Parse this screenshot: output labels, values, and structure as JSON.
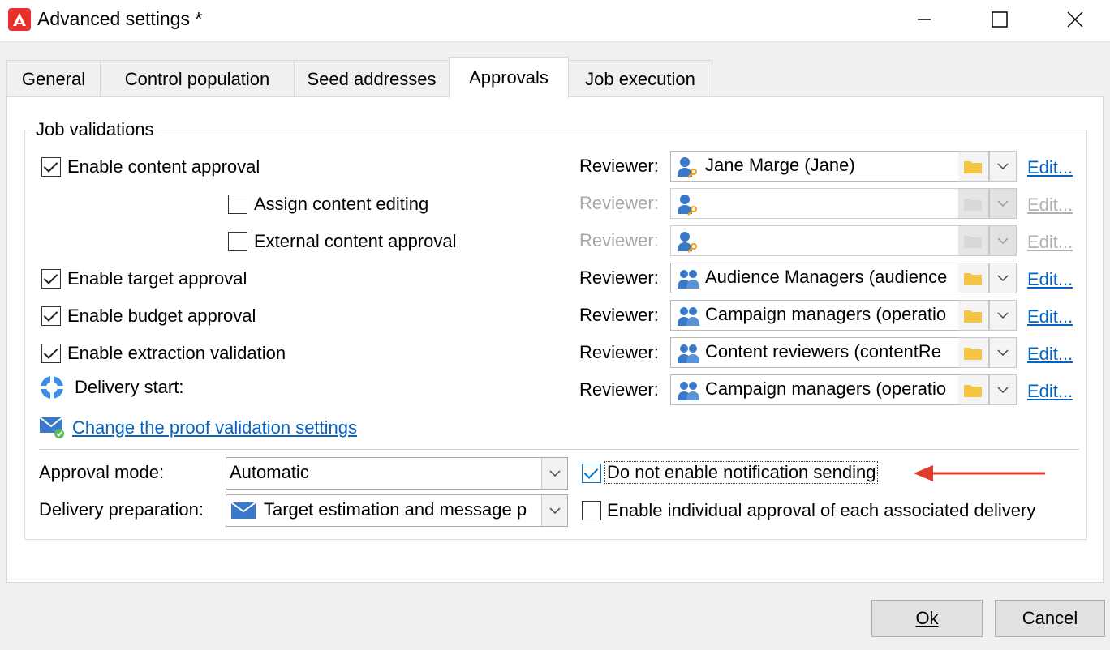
{
  "window": {
    "title": "Advanced settings *"
  },
  "tabs": [
    {
      "label": "General"
    },
    {
      "label": "Control population"
    },
    {
      "label": "Seed addresses"
    },
    {
      "label": "Approvals",
      "active": true
    },
    {
      "label": "Job execution"
    }
  ],
  "job_validations": {
    "legend": "Job validations",
    "rows": [
      {
        "label": "Enable content approval",
        "checked": true,
        "reviewer_label": "Reviewer:",
        "reviewer_value": "Jane Marge (Jane)",
        "reviewer_icon": "user-key-icon",
        "enabled": true,
        "edit": "Edit..."
      },
      {
        "label": "Assign content editing",
        "checked": false,
        "reviewer_label": "Reviewer:",
        "reviewer_value": "",
        "reviewer_icon": "user-key-icon",
        "enabled": false,
        "edit": "Edit..."
      },
      {
        "label": "External content approval",
        "checked": false,
        "reviewer_label": "Reviewer:",
        "reviewer_value": "",
        "reviewer_icon": "user-key-icon",
        "enabled": false,
        "edit": "Edit..."
      },
      {
        "label": "Enable target approval",
        "checked": true,
        "reviewer_label": "Reviewer:",
        "reviewer_value": "Audience Managers (audience",
        "reviewer_icon": "group-icon",
        "enabled": true,
        "edit": "Edit..."
      },
      {
        "label": "Enable budget approval",
        "checked": true,
        "reviewer_label": "Reviewer:",
        "reviewer_value": "Campaign managers (operatio",
        "reviewer_icon": "group-icon",
        "enabled": true,
        "edit": "Edit..."
      },
      {
        "label": "Enable extraction validation",
        "checked": true,
        "reviewer_label": "Reviewer:",
        "reviewer_value": "Content reviewers (contentRe",
        "reviewer_icon": "group-icon",
        "enabled": true,
        "edit": "Edit..."
      },
      {
        "label": "Delivery start:",
        "checked": null,
        "reviewer_label": "Reviewer:",
        "reviewer_value": "Campaign managers (operatio",
        "reviewer_icon": "group-icon",
        "enabled": true,
        "edit": "Edit..."
      }
    ],
    "proof_link": "Change the proof validation settings"
  },
  "approval_mode": {
    "label": "Approval mode:",
    "value": "Automatic"
  },
  "delivery_preparation": {
    "label": "Delivery preparation:",
    "value": "Target estimation and message p"
  },
  "options": {
    "no_notification": {
      "label": "Do not enable notification sending",
      "checked": true
    },
    "individual_approval": {
      "label": "Enable individual approval of each associated delivery",
      "checked": false
    }
  },
  "buttons": {
    "ok": "Ok",
    "cancel": "Cancel"
  },
  "colors": {
    "annotation_arrow": "#e03c2c",
    "link": "#0563c1",
    "icon_blue": "#3a78c9",
    "folder": "#f4c542"
  }
}
